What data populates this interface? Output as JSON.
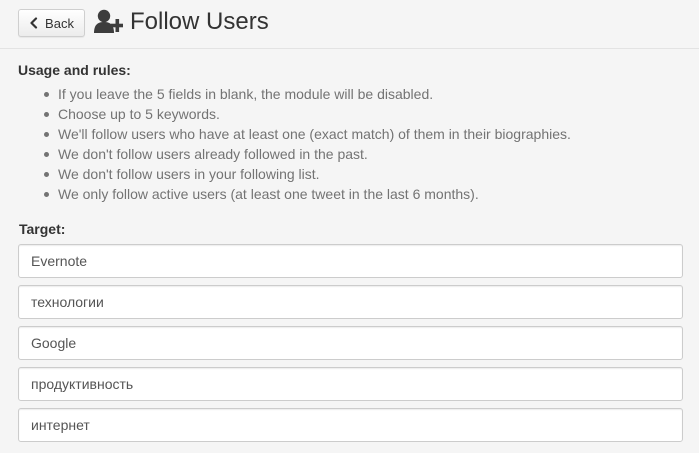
{
  "header": {
    "back_label": "Back",
    "title": "Follow Users",
    "title_icon": "user-plus-icon"
  },
  "usage": {
    "heading": "Usage and rules:",
    "rules": [
      "If you leave the 5 fields in blank, the module will be disabled.",
      "Choose up to 5 keywords.",
      "We'll follow users who have at least one (exact match) of them in their biographies.",
      "We don't follow users already followed in the past.",
      "We don't follow users in your following list.",
      "We only follow active users (at least one tweet in the last 6 months)."
    ]
  },
  "target": {
    "label": "Target:",
    "keywords": [
      "Evernote",
      "технологии",
      "Google",
      "продуктивность",
      "интернет"
    ]
  },
  "colors": {
    "page_background": "#f5f5f5",
    "heading_text": "#333333",
    "rule_text": "#737373",
    "input_border": "#cccccc"
  }
}
